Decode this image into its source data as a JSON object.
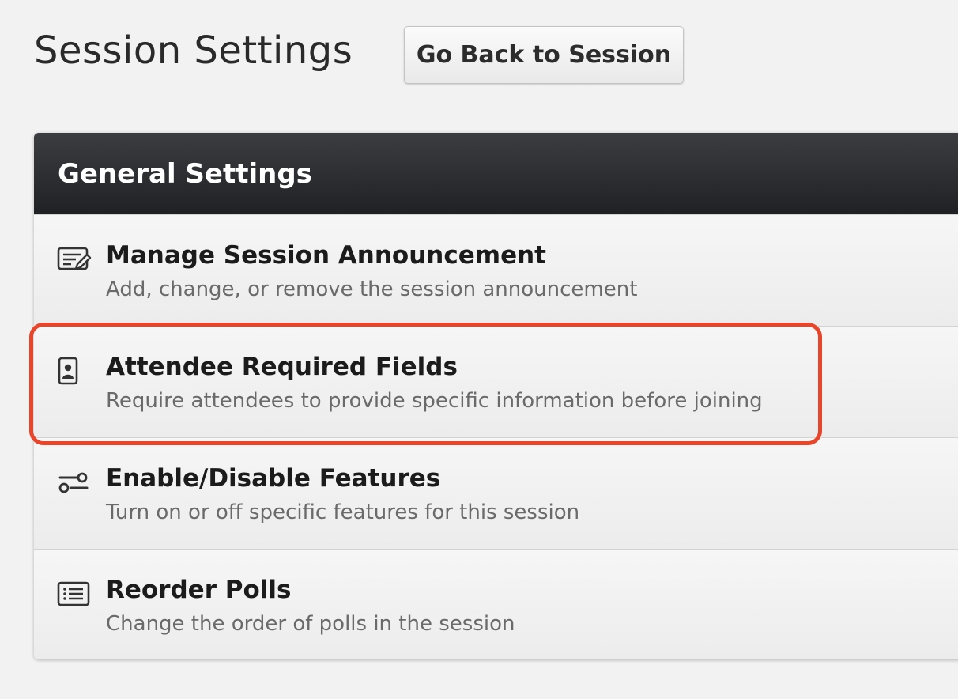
{
  "page": {
    "title": "Session Settings",
    "back_button_label": "Go Back to Session"
  },
  "panel": {
    "title": "General Settings",
    "items": [
      {
        "label": "Manage Session Announcement",
        "description": "Add, change, or remove the session announcement",
        "icon": "edit-announcement-icon"
      },
      {
        "label": "Attendee Required Fields",
        "description": "Require attendees to provide specific information before joining",
        "icon": "id-badge-icon",
        "highlighted": true
      },
      {
        "label": "Enable/Disable Features",
        "description": "Turn on or off specific features for this session",
        "icon": "toggle-features-icon"
      },
      {
        "label": "Reorder Polls",
        "description": "Change the order of polls in the session",
        "icon": "list-icon"
      }
    ]
  },
  "colors": {
    "background": "#f2f2f2",
    "header": "#25272a",
    "highlight": "#e8452b",
    "description_text": "#6a6a6a"
  }
}
